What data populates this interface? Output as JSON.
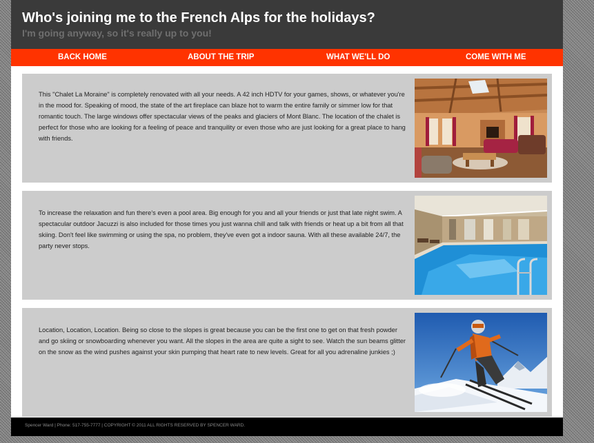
{
  "header": {
    "title": "Who's joining me to the French Alps for the holidays?",
    "subtitle": "I'm going anyway, so it's really up to you!"
  },
  "nav": {
    "items": [
      {
        "label": "BACK HOME"
      },
      {
        "label": "ABOUT THE TRIP"
      },
      {
        "label": "WHAT WE'LL DO"
      },
      {
        "label": "COME WITH ME"
      }
    ]
  },
  "sections": [
    {
      "text": "This \"Chalet La Moraine\" is completely renovated with all your needs. A 42 inch HDTV for your games, shows, or whatever you're in the mood for. Speaking of mood, the state of the art fireplace can blaze hot to warm the entire family or simmer low for that romantic touch. The large windows offer spectacular views of the peaks and glaciers of Mont Blanc. The location of the chalet is perfect for those who are looking for a feeling of peace and tranquility or even those who are just looking for a great place to hang with friends.",
      "image": "chalet-living-room"
    },
    {
      "text": "To increase the relaxation and fun there's even a pool area. Big enough for you and all your friends or just that late night swim. A spectacular outdoor Jacuzzi is also included for those times you just wanna chill and talk with friends or heat up a bit from all that skiing. Don't feel like swimming or using the spa, no problem, they've even got a indoor sauna. With all these available 24/7, the party never stops.",
      "image": "indoor-pool"
    },
    {
      "text": "Location, Location, Location. Being so close to the slopes is great because you can be the first one to get on that fresh powder and go skiing or snowboarding whenever you want. All the slopes in the area are quite a sight to see. Watch the sun beams glitter on the snow as the wind pushes against your skin pumping that heart rate to new levels. Great for all you adrenaline junkies ;)",
      "image": "skier"
    }
  ],
  "footer": {
    "text": "Spencer Ward | Phone: 517-755-7777 | COPYRIGHT © 2011 ALL RIGHTS RESERVED BY SPENCER WARD."
  },
  "colors": {
    "header_bg": "#3a3a3a",
    "nav_bg": "#ff3300",
    "panel_bg": "#cccccc",
    "footer_bg": "#000000"
  }
}
